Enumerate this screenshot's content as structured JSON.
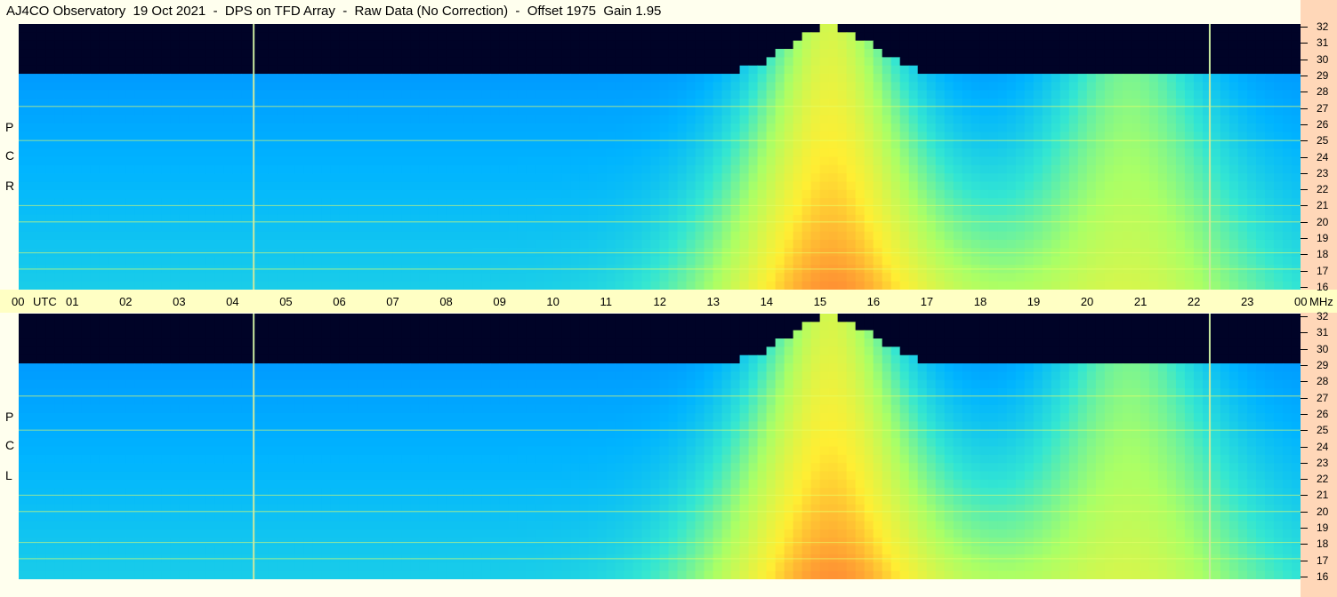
{
  "title": "AJ4CO Observatory  19 Oct 2021  -  DPS on TFD Array  -  Raw Data (No Correction)  -  Offset 1975  Gain 1.95",
  "colors": {
    "background": "#ffffee",
    "axis_band": "#ffffc4",
    "side_strip": "#ffd7b8"
  },
  "chart_data": {
    "type": "heatmap",
    "x_axis": {
      "unit_label": "UTC",
      "ticks": [
        "00",
        "01",
        "02",
        "03",
        "04",
        "05",
        "06",
        "07",
        "08",
        "09",
        "10",
        "11",
        "12",
        "13",
        "14",
        "15",
        "16",
        "17",
        "18",
        "19",
        "20",
        "21",
        "22",
        "23",
        "00"
      ],
      "range_hours": [
        0,
        24
      ]
    },
    "y_axis": {
      "unit_label": "MHz",
      "ticks": [
        32,
        31,
        30,
        29,
        28,
        27,
        26,
        25,
        24,
        23,
        22,
        21,
        20,
        19,
        18,
        17,
        16
      ],
      "range": [
        16,
        32
      ]
    },
    "panels": [
      {
        "label_letters": [
          "R",
          "C",
          "P"
        ]
      },
      {
        "label_letters": [
          "L",
          "C",
          "P"
        ]
      }
    ],
    "colormap": [
      "#000018",
      "#00116b",
      "#0036c8",
      "#0072ff",
      "#00b4ff",
      "#33e6d2",
      "#aaff66",
      "#ffee33",
      "#ff4d33",
      "#cc00aa"
    ],
    "features": {
      "solar_peaks_utc": [
        15.2,
        20.8
      ],
      "ionosphere_cutoff_mhz_night": 29.5,
      "interference_bands_mhz": [
        27.1,
        25.0,
        21.0,
        20.0,
        18.1,
        17.1
      ],
      "vertical_markers_utc": [
        4.4,
        22.3
      ]
    }
  },
  "time_axis": {
    "labels": [
      "00",
      "UTC",
      "01",
      "02",
      "03",
      "04",
      "05",
      "06",
      "07",
      "08",
      "09",
      "10",
      "11",
      "12",
      "13",
      "14",
      "15",
      "16",
      "17",
      "18",
      "19",
      "20",
      "21",
      "22",
      "23",
      "00",
      "MHz"
    ]
  }
}
